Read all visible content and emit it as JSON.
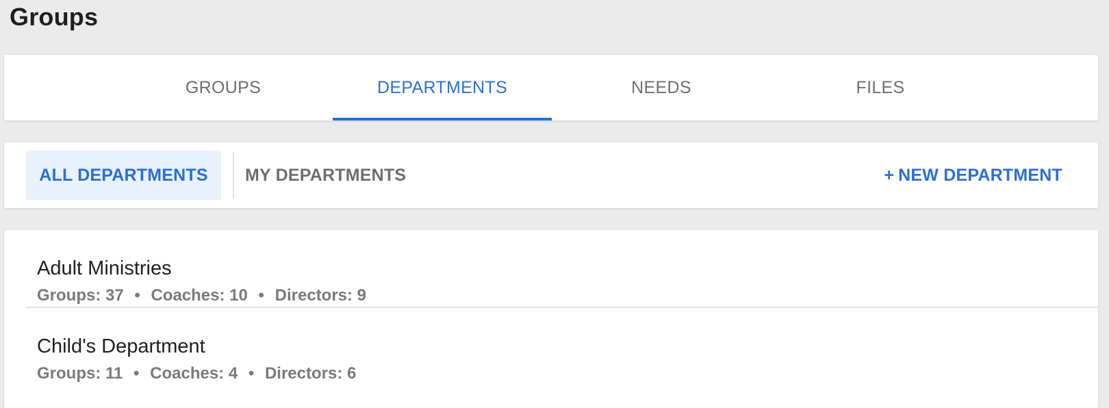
{
  "page": {
    "title": "Groups"
  },
  "tabs": [
    {
      "label": "GROUPS",
      "active": false
    },
    {
      "label": "DEPARTMENTS",
      "active": true
    },
    {
      "label": "NEEDS",
      "active": false
    },
    {
      "label": "FILES",
      "active": false
    }
  ],
  "filters": {
    "all_label": "ALL DEPARTMENTS",
    "mine_label": "MY DEPARTMENTS",
    "new_plus": "+",
    "new_label": "NEW DEPARTMENT"
  },
  "departments": [
    {
      "name": "Adult Ministries",
      "groups_label": "Groups:",
      "groups": "37",
      "coaches_label": "Coaches:",
      "coaches": "10",
      "directors_label": "Directors:",
      "directors": "9"
    },
    {
      "name": "Child's Department",
      "groups_label": "Groups:",
      "groups": "11",
      "coaches_label": "Coaches:",
      "coaches": "4",
      "directors_label": "Directors:",
      "directors": "6"
    }
  ],
  "separator": "•",
  "colors": {
    "accent": "#2a6fdb",
    "active_filter_bg": "#e8f1fc",
    "muted_text": "#6e6e6e",
    "page_bg": "#ebebeb"
  }
}
